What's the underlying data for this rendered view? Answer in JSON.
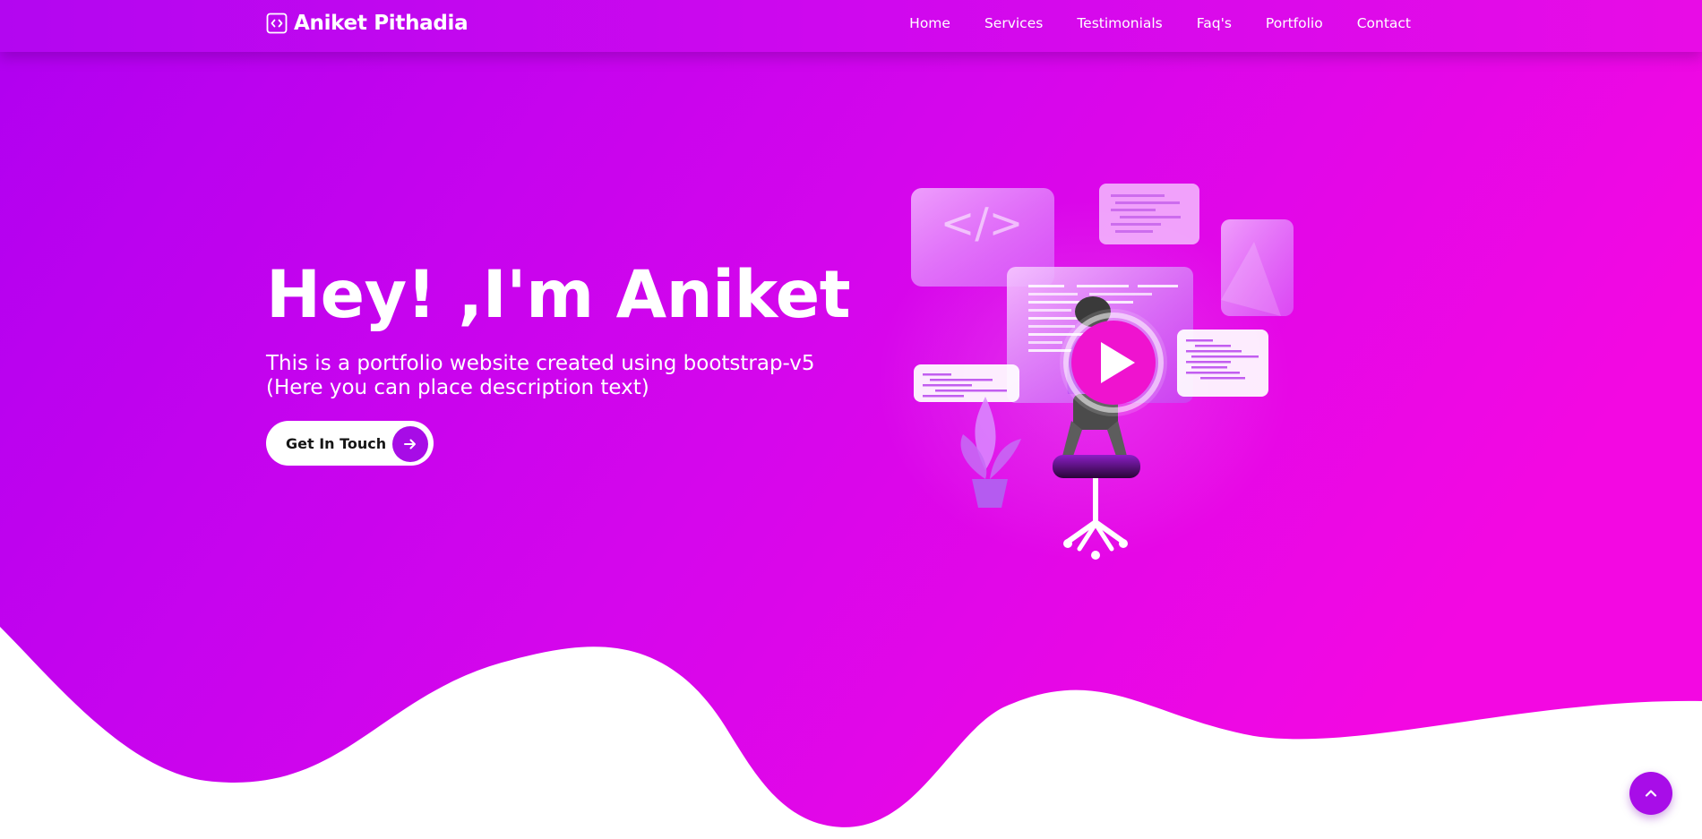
{
  "brand": {
    "name": "Aniket Pithadia",
    "icon": "code-icon"
  },
  "nav": {
    "items": [
      {
        "label": "Home"
      },
      {
        "label": "Services"
      },
      {
        "label": "Testimonials"
      },
      {
        "label": "Faq's"
      },
      {
        "label": "Portfolio"
      },
      {
        "label": "Contact"
      }
    ]
  },
  "hero": {
    "title": "Hey! ,I'm Aniket",
    "description_line1": "This is a portfolio website created using bootstrap-v5",
    "description_line2": "(Here you can place description text)",
    "cta_label": "Get In Touch",
    "cta_icon": "arrow-right-icon",
    "illustration_code_tag": "</>"
  },
  "scroll_top": {
    "icon": "chevron-up-icon"
  },
  "colors": {
    "gradient_start": "#b000f0",
    "gradient_end": "#f308e2",
    "accent": "#a70ce6",
    "button_bg": "#ffffff"
  }
}
